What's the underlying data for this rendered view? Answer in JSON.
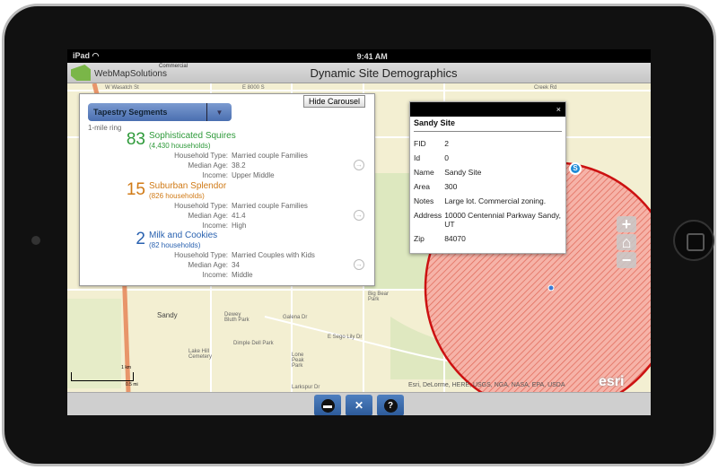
{
  "status_bar": {
    "device": "iPad",
    "wifi_icon": "wifi-icon",
    "time": "9:41 AM"
  },
  "header": {
    "logo_text": "WebMapSolutions",
    "logo_sub": "Commercial",
    "title": "Dynamic Site Demographics"
  },
  "carousel": {
    "hide_label": "Hide Carousel",
    "dropdown_label": "Tapestry Segments",
    "ring_label": "1-mile ring",
    "segments": [
      {
        "rank": "83",
        "name": "Sophisticated Squires",
        "households": "(4,430 households)",
        "household_type": "Married couple Families",
        "median_age": "38.2",
        "income": "Upper Middle",
        "color": "#2e9a3a"
      },
      {
        "rank": "15",
        "name": "Suburban Splendor",
        "households": "(826 households)",
        "household_type": "Married couple Families",
        "median_age": "41.4",
        "income": "High",
        "color": "#d07a16"
      },
      {
        "rank": "2",
        "name": "Milk and Cookies",
        "households": "(82 households)",
        "household_type": "Married Couples with Kids",
        "median_age": "34",
        "income": "Middle",
        "color": "#2a62b0"
      }
    ],
    "labels": {
      "household_type": "Household Type:",
      "median_age": "Median Age:",
      "income": "Income:"
    }
  },
  "popup": {
    "close": "×",
    "title": "Sandy Site",
    "fields": [
      {
        "k": "FID",
        "v": "2"
      },
      {
        "k": "Id",
        "v": "0"
      },
      {
        "k": "Name",
        "v": "Sandy Site"
      },
      {
        "k": "Area",
        "v": "300"
      },
      {
        "k": "Notes",
        "v": "Large lot. Commercial zoning."
      },
      {
        "k": "Address",
        "v": "10000 Centennial Parkway Sandy, UT"
      },
      {
        "k": "Zip",
        "v": "84070"
      }
    ]
  },
  "map": {
    "labels": [
      "W Wasatch St",
      "E 8000 S",
      "Creek Rd",
      "Sandy",
      "Dimple Dell Park",
      "Lone Peak Park",
      "Lake Hill Cemetery",
      "E Sego Lily Dr",
      "Larkspur Dr",
      "Big Bear Park",
      "Galena Dr",
      "Dewey Bluth Park"
    ],
    "scale_km": "1 km",
    "scale_mi": "0.5 mi",
    "attribution": "Esri, DeLorme, HERE, USGS, NGA, NASA, EPA, USDA",
    "esri": "esri",
    "pin": "S",
    "zoom_in": "+",
    "zoom_out": "−"
  },
  "toolbar": {
    "help": "?"
  }
}
